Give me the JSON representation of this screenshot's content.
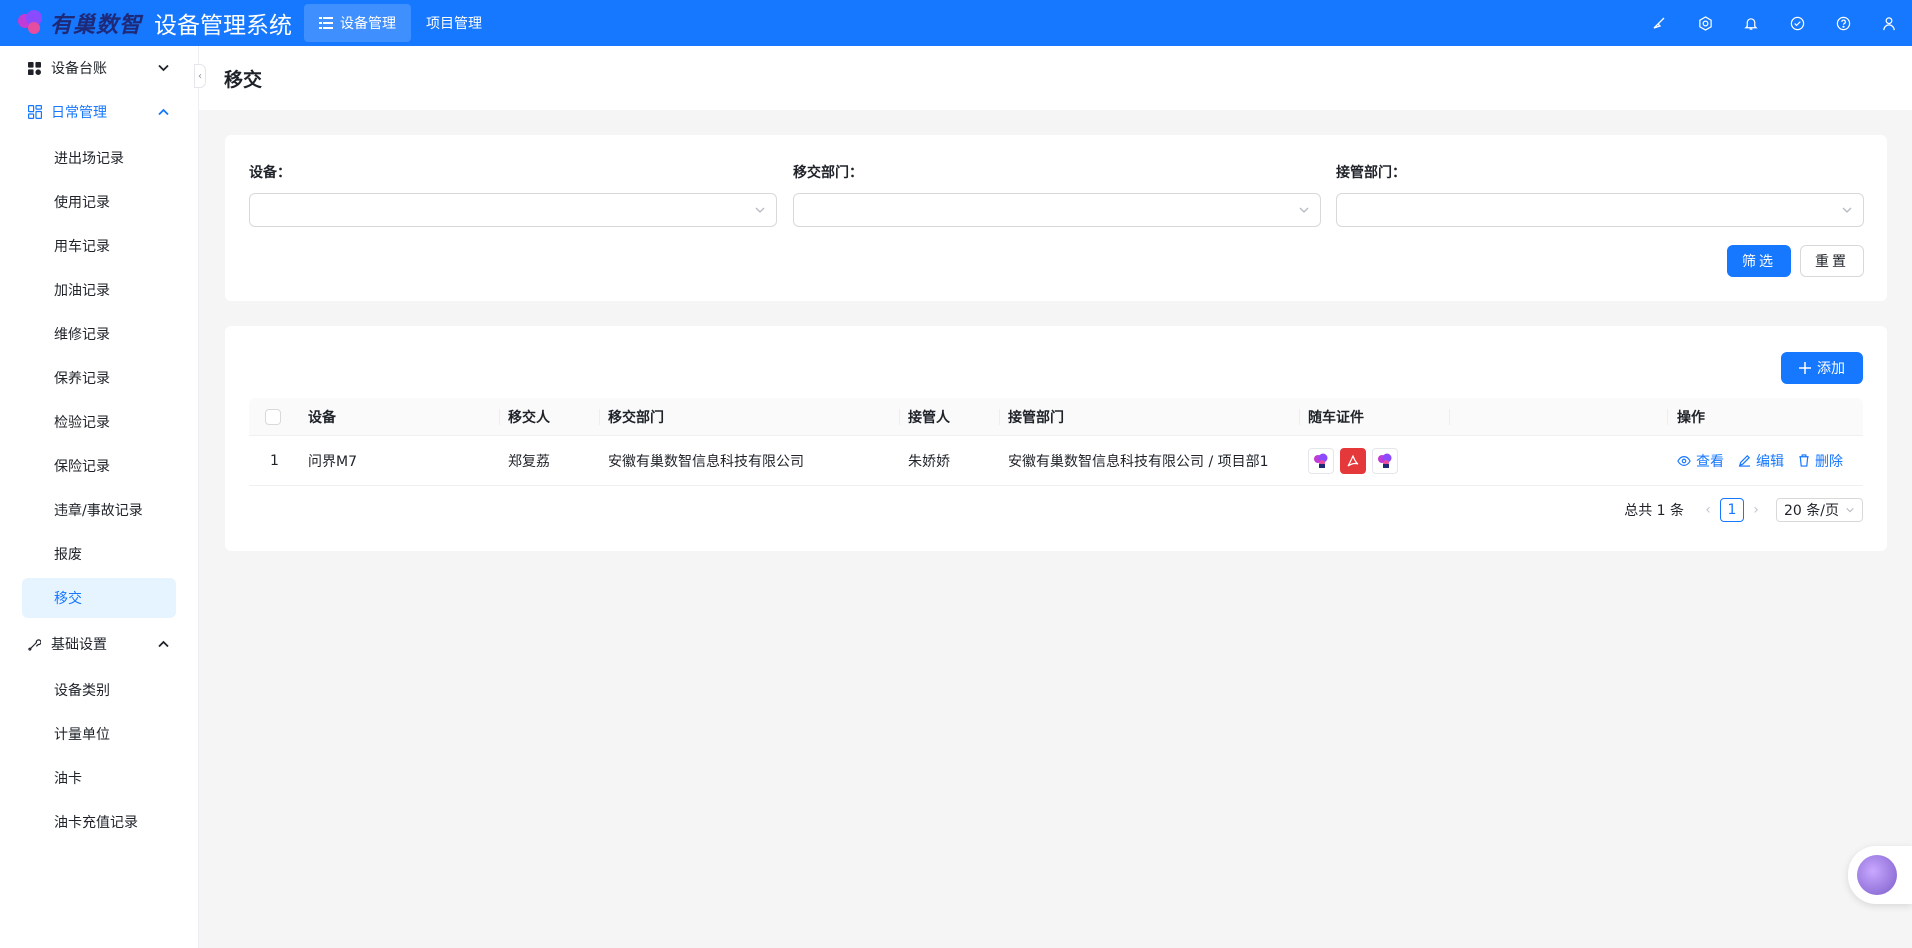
{
  "header": {
    "logo_text": "有巢数智",
    "system_title": "设备管理系统",
    "nav": [
      {
        "label": "设备管理",
        "active": true
      },
      {
        "label": "项目管理",
        "active": false
      }
    ],
    "icons": [
      "brush-icon",
      "gear-icon",
      "bell-icon",
      "check-circle-icon",
      "help-icon",
      "user-icon"
    ]
  },
  "sidebar": {
    "groups": [
      {
        "label": "设备台账",
        "icon": "apps-icon",
        "open": false,
        "items": []
      },
      {
        "label": "日常管理",
        "icon": "dashboard-icon",
        "open": true,
        "items": [
          "进出场记录",
          "使用记录",
          "用车记录",
          "加油记录",
          "维修记录",
          "保养记录",
          "检验记录",
          "保险记录",
          "违章/事故记录",
          "报废",
          "移交"
        ]
      },
      {
        "label": "基础设置",
        "icon": "tool-icon",
        "open": true,
        "items": [
          "设备类别",
          "计量单位",
          "油卡",
          "油卡充值记录"
        ]
      }
    ],
    "active_item": "移交"
  },
  "page": {
    "title": "移交"
  },
  "filters": {
    "fields": [
      {
        "label": "设备：",
        "value": ""
      },
      {
        "label": "移交部门：",
        "value": ""
      },
      {
        "label": "接管部门：",
        "value": ""
      }
    ],
    "filter_button": "筛选",
    "reset_button": "重置"
  },
  "table": {
    "add_button": "添加",
    "columns": [
      "设备",
      "移交人",
      "移交部门",
      "接管人",
      "接管部门",
      "随车证件",
      "操作"
    ],
    "rows": [
      {
        "index": "1",
        "device": "问界M7",
        "handover_person": "郑复荔",
        "handover_dept": "安徽有巢数智信息科技有限公司",
        "receiver": "朱娇娇",
        "receiver_dept": "安徽有巢数智信息科技有限公司 / 项目部1",
        "documents": [
          "logo-doc-icon",
          "pdf-icon",
          "logo-doc-icon"
        ],
        "actions": [
          "查看",
          "编辑",
          "删除"
        ]
      }
    ]
  },
  "pagination": {
    "total": "总共 1 条",
    "current_page": "1",
    "page_size": "20 条/页"
  }
}
